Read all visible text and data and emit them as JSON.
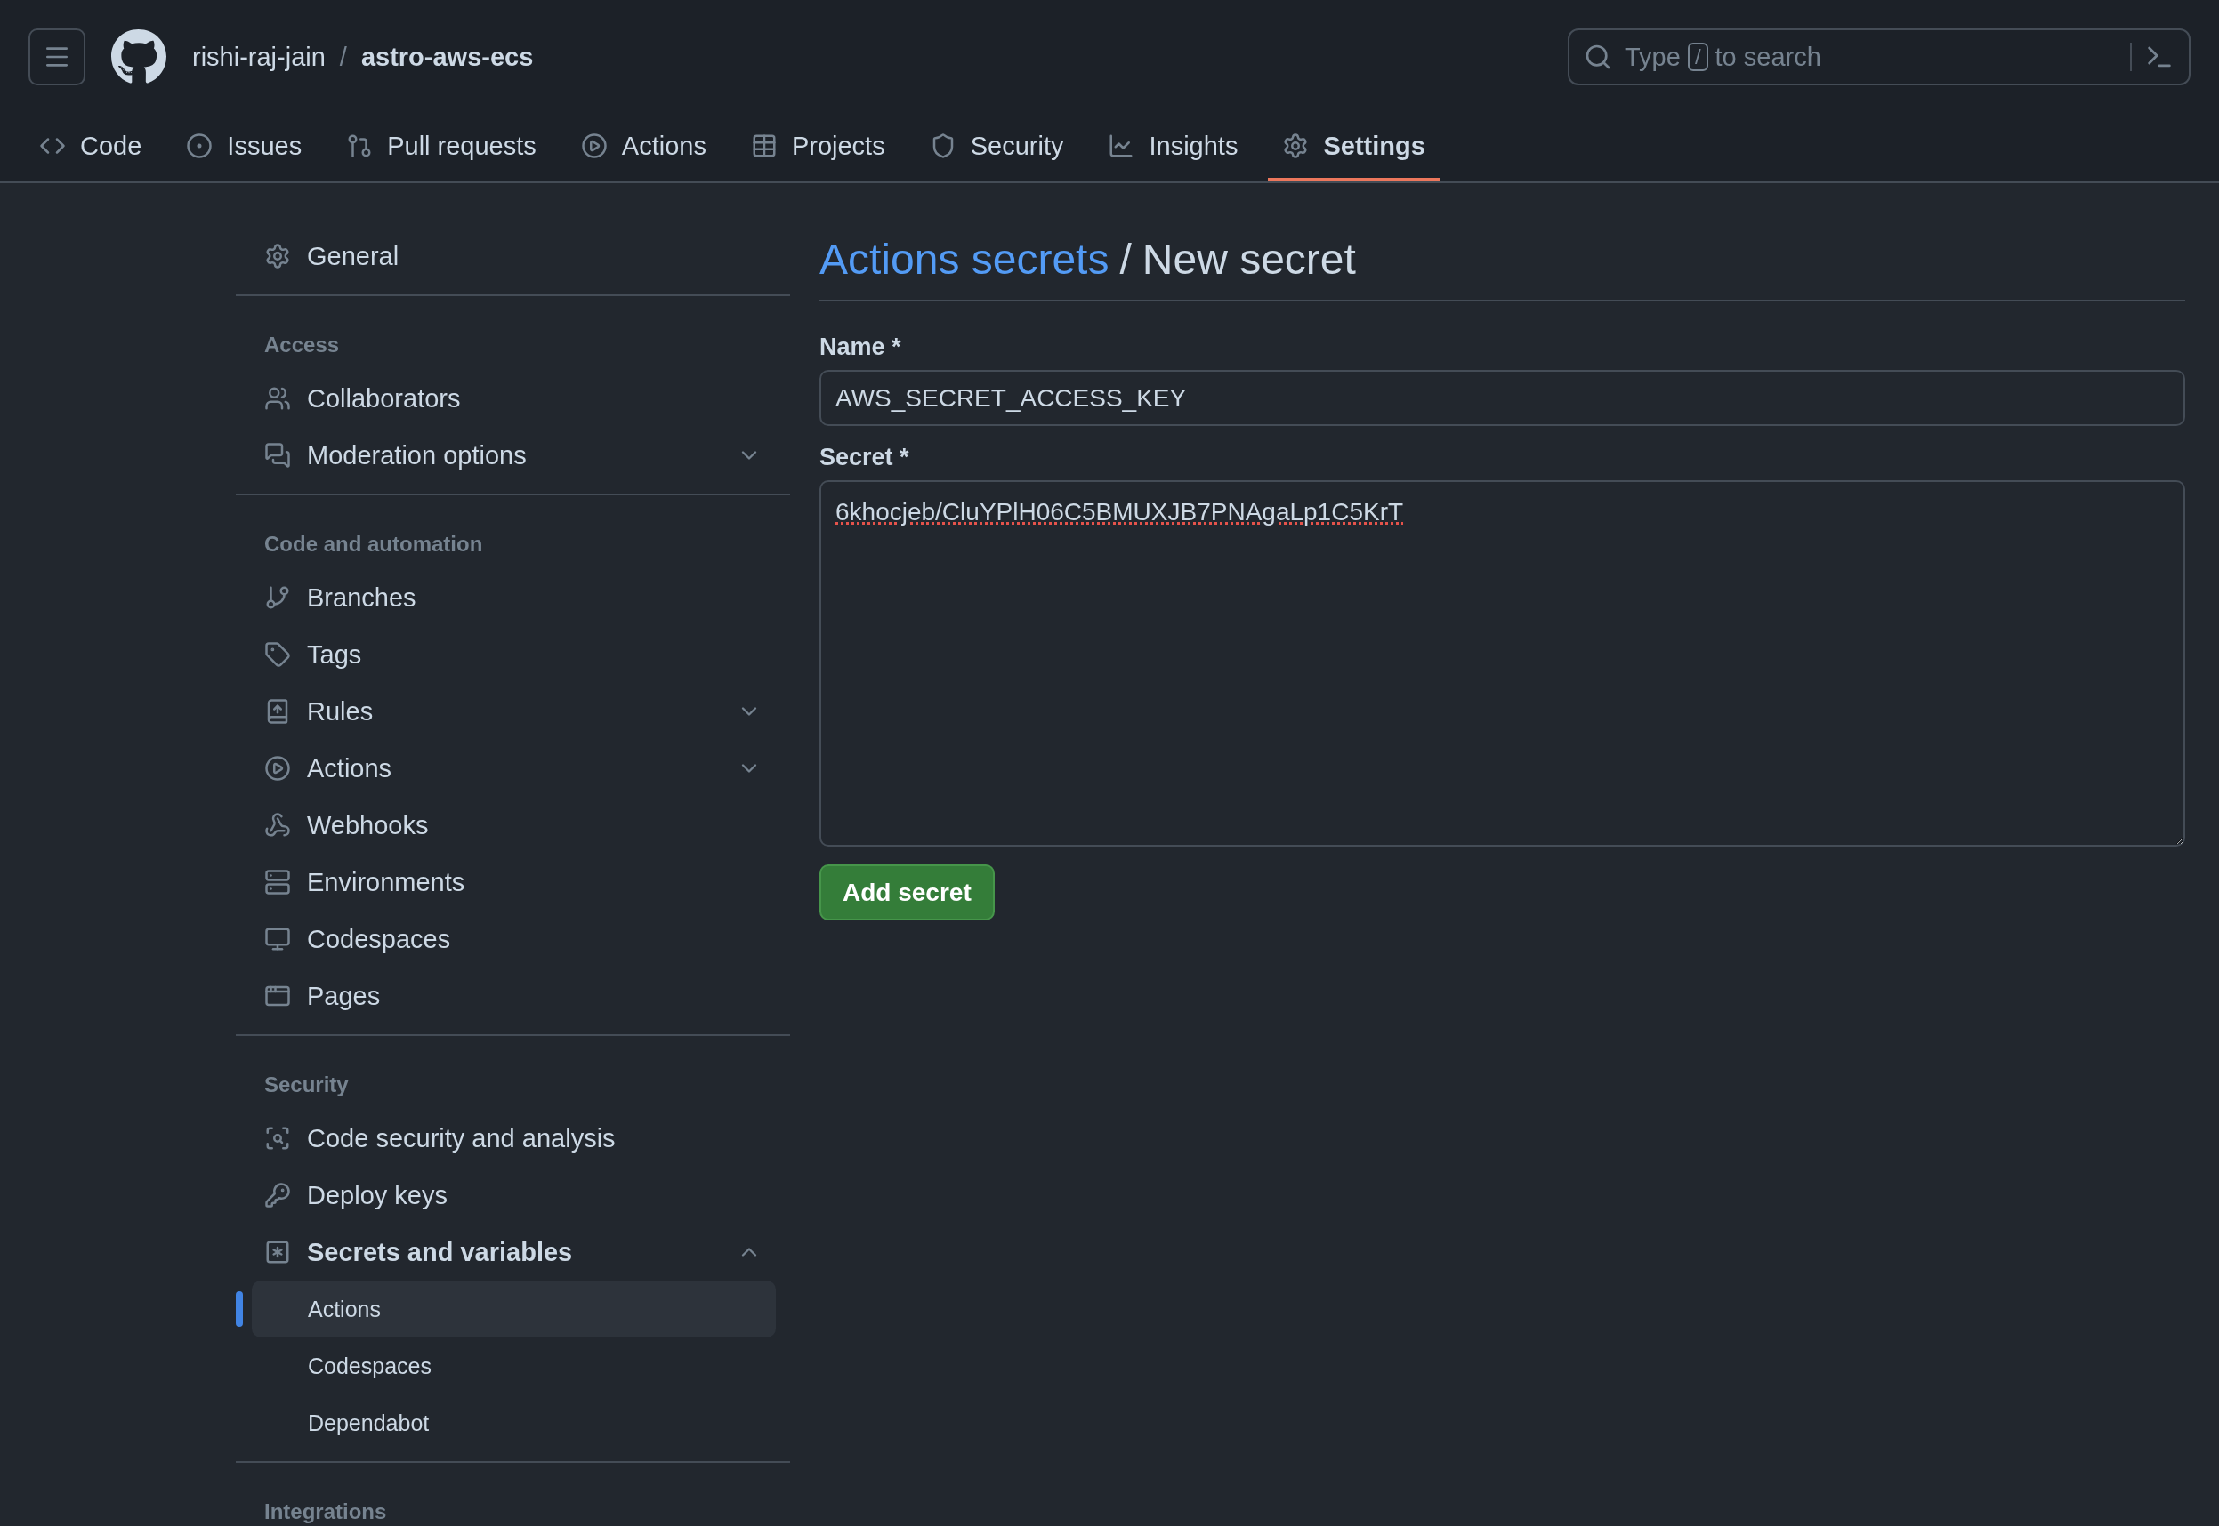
{
  "header": {
    "owner": "rishi-raj-jain",
    "separator": "/",
    "repo": "astro-aws-ecs",
    "search": {
      "prefix": "Type",
      "key": "/",
      "suffix": "to search"
    }
  },
  "tabs": [
    {
      "label": "Code",
      "selected": false
    },
    {
      "label": "Issues",
      "selected": false
    },
    {
      "label": "Pull requests",
      "selected": false
    },
    {
      "label": "Actions",
      "selected": false
    },
    {
      "label": "Projects",
      "selected": false
    },
    {
      "label": "Security",
      "selected": false
    },
    {
      "label": "Insights",
      "selected": false
    },
    {
      "label": "Settings",
      "selected": true
    }
  ],
  "sidebar": {
    "top": {
      "label": "General"
    },
    "sections": [
      {
        "heading": "Access",
        "items": [
          {
            "kind": "link",
            "label": "Collaborators"
          },
          {
            "kind": "group",
            "label": "Moderation options",
            "expanded": false
          }
        ]
      },
      {
        "heading": "Code and automation",
        "items": [
          {
            "kind": "link",
            "label": "Branches"
          },
          {
            "kind": "link",
            "label": "Tags"
          },
          {
            "kind": "group",
            "label": "Rules",
            "expanded": false
          },
          {
            "kind": "group",
            "label": "Actions",
            "expanded": false
          },
          {
            "kind": "link",
            "label": "Webhooks"
          },
          {
            "kind": "link",
            "label": "Environments"
          },
          {
            "kind": "link",
            "label": "Codespaces"
          },
          {
            "kind": "link",
            "label": "Pages"
          }
        ]
      },
      {
        "heading": "Security",
        "items": [
          {
            "kind": "link",
            "label": "Code security and analysis"
          },
          {
            "kind": "link",
            "label": "Deploy keys"
          },
          {
            "kind": "group",
            "label": "Secrets and variables",
            "expanded": true,
            "children": [
              {
                "label": "Actions",
                "selected": true
              },
              {
                "label": "Codespaces",
                "selected": false
              },
              {
                "label": "Dependabot",
                "selected": false
              }
            ]
          }
        ]
      },
      {
        "heading": "Integrations"
      }
    ]
  },
  "main": {
    "breadcrumb": {
      "link": "Actions secrets",
      "separator": "/",
      "current": "New secret"
    },
    "name_field": {
      "label": "Name *",
      "value": "AWS_SECRET_ACCESS_KEY"
    },
    "secret_field": {
      "label": "Secret *",
      "value": "6khocjeb/CluYPlH06C5BMUXJB7PNAgaLp1C5KrT"
    },
    "submit": "Add secret"
  }
}
